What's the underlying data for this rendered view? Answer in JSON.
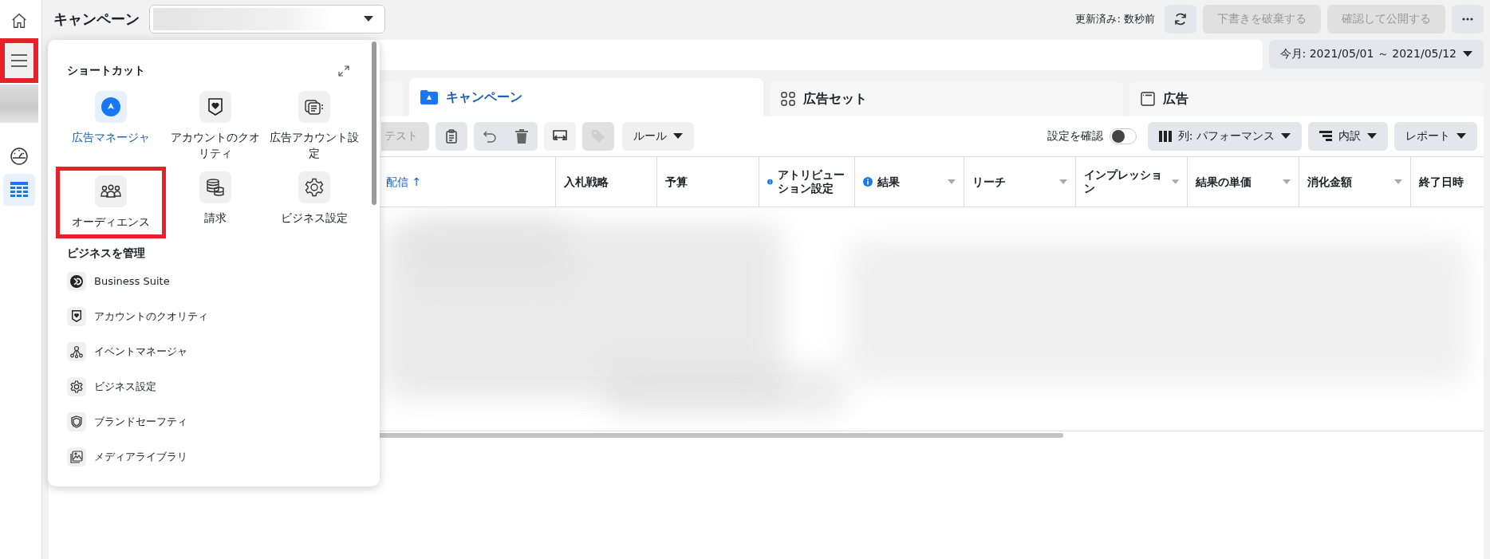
{
  "rail": {
    "items": [
      {
        "kind": "home",
        "selected": false,
        "highlighted": false
      },
      {
        "kind": "menu",
        "selected": false,
        "highlighted": true
      },
      {
        "kind": "gauge",
        "selected": false,
        "highlighted": false
      },
      {
        "kind": "table",
        "selected": true,
        "highlighted": false
      }
    ]
  },
  "header": {
    "title": "キャンペーン",
    "updated": "更新済み: 数秒前",
    "buttons": [
      {
        "label": "下書きを破棄する",
        "disabled": true
      },
      {
        "label": "確認して公開する",
        "disabled": true
      }
    ]
  },
  "date_range": "今月: 2021/05/01 ～ 2021/05/12",
  "tabs": [
    {
      "kind": "campaign",
      "label": "キャンペーン",
      "selected": true
    },
    {
      "kind": "adset",
      "label": "広告セット",
      "selected": false
    },
    {
      "kind": "ad",
      "label": "広告",
      "selected": false
    }
  ],
  "toolbar": {
    "left": [
      {
        "kind": "text",
        "label": "テスト",
        "disabled": true
      },
      {
        "kind": "clipboard",
        "disabled": false
      },
      {
        "kind": "undo",
        "disabled": false
      },
      {
        "kind": "delete",
        "disabled": false
      },
      {
        "kind": "swap",
        "disabled": false
      },
      {
        "kind": "tag",
        "disabled": true
      },
      {
        "kind": "dropdown",
        "label": "ルール",
        "disabled": false
      }
    ],
    "review": {
      "label": "設定を確認",
      "on": false
    },
    "right": [
      {
        "kind": "columns",
        "label": "列: パフォーマンス"
      },
      {
        "kind": "breakdown",
        "label": "内訳"
      },
      {
        "kind": "plain",
        "label": "レポート"
      }
    ]
  },
  "table": {
    "columns": [
      {
        "label": "配信 ↑",
        "sorted": true,
        "info": false,
        "menu": false
      },
      {
        "label": "入札戦略",
        "sorted": false,
        "info": false,
        "menu": false
      },
      {
        "label": "予算",
        "sorted": false,
        "info": false,
        "menu": false
      },
      {
        "label": "アトリビューション設定",
        "sorted": false,
        "info": true,
        "menu": false
      },
      {
        "label": "結果",
        "sorted": false,
        "info": true,
        "menu": true
      },
      {
        "label": "リーチ",
        "sorted": false,
        "info": false,
        "menu": true
      },
      {
        "label": "インプレッション",
        "sorted": false,
        "info": false,
        "menu": true
      },
      {
        "label": "結果の単価",
        "sorted": false,
        "info": false,
        "menu": true
      },
      {
        "label": "消化金額",
        "sorted": false,
        "info": false,
        "menu": true
      },
      {
        "label": "終了日時",
        "sorted": false,
        "info": false,
        "menu": false
      }
    ]
  },
  "menu": {
    "shortcuts_title": "ショートカット",
    "shortcuts": [
      {
        "kind": "ads-manager",
        "label": "広告マネージャ",
        "selected": true,
        "highlighted": false
      },
      {
        "kind": "quality",
        "label": "アカウントのクオリティ",
        "selected": false,
        "highlighted": false
      },
      {
        "kind": "account-settings",
        "label": "広告アカウント設定",
        "selected": false,
        "highlighted": false
      },
      {
        "kind": "audience",
        "label": "オーディエンス",
        "selected": false,
        "highlighted": true
      },
      {
        "kind": "billing",
        "label": "請求",
        "selected": false,
        "highlighted": false
      },
      {
        "kind": "settings",
        "label": "ビジネス設定",
        "selected": false,
        "highlighted": false
      }
    ],
    "manage_title": "ビジネスを管理",
    "items": [
      {
        "kind": "business-suite",
        "label": "Business Suite"
      },
      {
        "kind": "quality",
        "label": "アカウントのクオリティ"
      },
      {
        "kind": "events",
        "label": "イベントマネージャ"
      },
      {
        "kind": "settings",
        "label": "ビジネス設定"
      },
      {
        "kind": "shield",
        "label": "ブランドセーフティ"
      },
      {
        "kind": "media",
        "label": "メディアライブラリ"
      }
    ]
  }
}
